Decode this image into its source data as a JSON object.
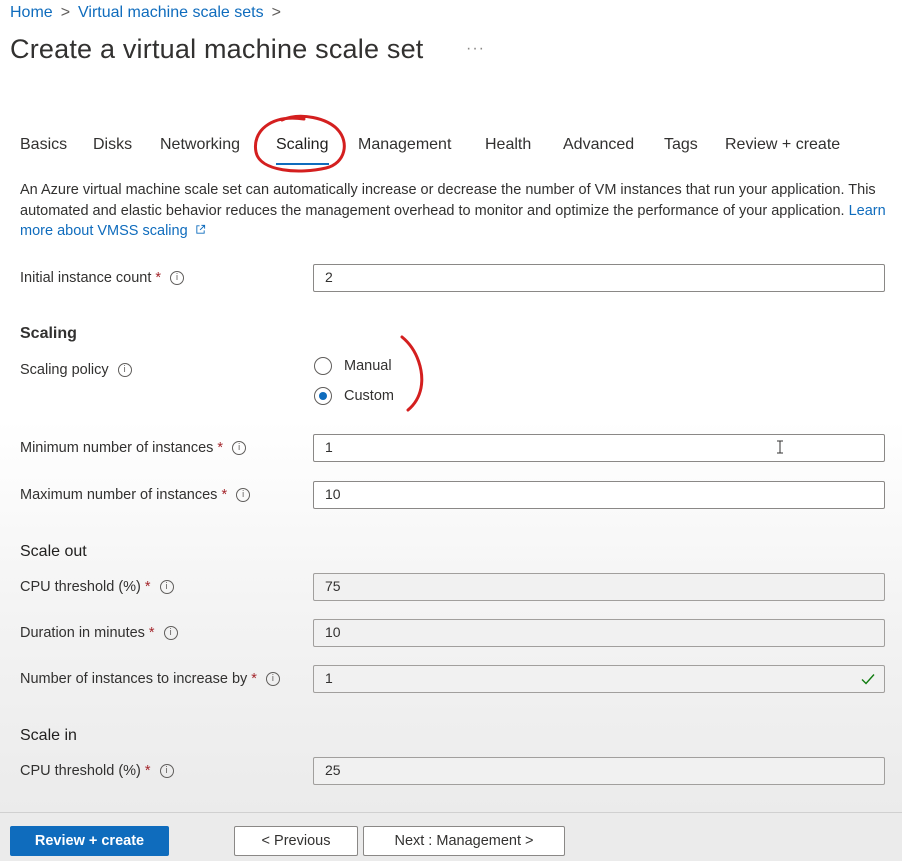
{
  "breadcrumb": {
    "home": "Home",
    "parent": "Virtual machine scale sets",
    "separator": ">"
  },
  "page": {
    "title": "Create a virtual machine scale set",
    "more": "···"
  },
  "tabs": [
    {
      "label": "Basics",
      "active": false
    },
    {
      "label": "Disks",
      "active": false
    },
    {
      "label": "Networking",
      "active": false
    },
    {
      "label": "Scaling",
      "active": true
    },
    {
      "label": "Management",
      "active": false
    },
    {
      "label": "Health",
      "active": false
    },
    {
      "label": "Advanced",
      "active": false
    },
    {
      "label": "Tags",
      "active": false
    },
    {
      "label": "Review + create",
      "active": false
    }
  ],
  "description": {
    "text": "An Azure virtual machine scale set can automatically increase or decrease the number of VM instances that run your application. This automated and elastic behavior reduces the management overhead to monitor and optimize the performance of your application.",
    "link": "Learn more about VMSS scaling"
  },
  "fields": {
    "initial_count": {
      "label": "Initial instance count",
      "required": "*",
      "value": "2"
    },
    "scaling_heading": "Scaling",
    "scaling_policy": {
      "label": "Scaling policy",
      "options": [
        "Manual",
        "Custom"
      ],
      "selected": "Custom"
    },
    "min_instances": {
      "label": "Minimum number of instances",
      "required": "*",
      "value": "1"
    },
    "max_instances": {
      "label": "Maximum number of instances",
      "required": "*",
      "value": "10"
    },
    "scale_out_heading": "Scale out",
    "so_cpu": {
      "label": "CPU threshold (%)",
      "required": "*",
      "value": "75"
    },
    "so_duration": {
      "label": "Duration in minutes",
      "required": "*",
      "value": "10"
    },
    "so_increase": {
      "label": "Number of instances to increase by",
      "required": "*",
      "value": "1"
    },
    "scale_in_heading": "Scale in",
    "si_cpu": {
      "label": "CPU threshold (%)",
      "required": "*",
      "value": "25"
    }
  },
  "footer": {
    "review_create": "Review + create",
    "previous": "< Previous",
    "next": "Next : Management >"
  },
  "colors": {
    "accent": "#0f6cbd",
    "required": "#a4262c",
    "annotation": "#d41f1f",
    "success": "#107c10"
  }
}
